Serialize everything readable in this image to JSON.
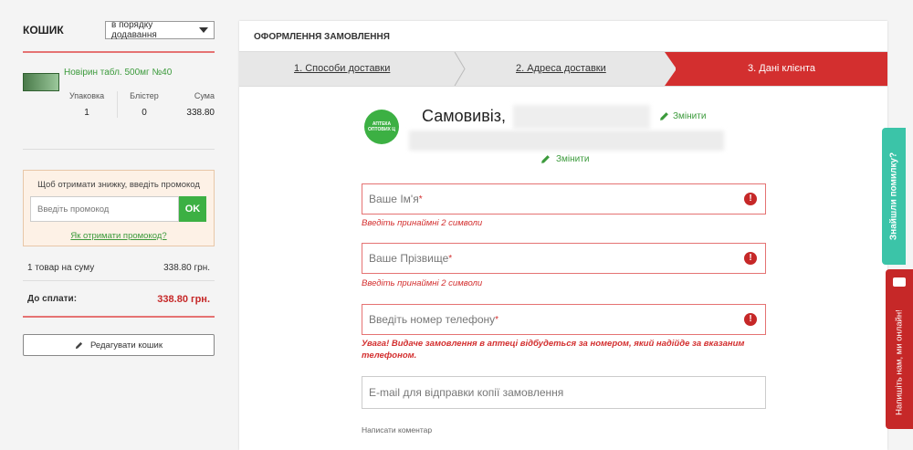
{
  "cart": {
    "title": "КОШИК",
    "sort_value": "в порядку додавання",
    "item": {
      "name": "Новірин табл. 500мг №40",
      "col_pack_label": "Упаковка",
      "col_blister_label": "Блістер",
      "col_sum_label": "Сума",
      "pack_qty": "1",
      "blister_qty": "0",
      "sum": "338.80"
    },
    "promo": {
      "text": "Щоб отримати знижку, введіть промокод",
      "placeholder": "Введіть промокод",
      "ok_label": "OK",
      "link": "Як отримати промокод?"
    },
    "summary": {
      "items_label": "1 товар на суму",
      "items_value": "338.80 грн.",
      "total_label": "До сплати:",
      "total_value": "338.80 грн."
    },
    "edit_label": "Редагувати кошик"
  },
  "checkout": {
    "title": "ОФОРМЛЕННЯ ЗАМОВЛЕННЯ",
    "steps": [
      "1. Способи доставки",
      "2. Адреса доставки",
      "3. Дані клієнта"
    ],
    "logo_text": "АПТЕКА ОПТОВИХ Ц",
    "pickup_label": "Самовивіз,",
    "change_label": "Змінити",
    "fields": {
      "first_name": "Ваше Ім'я",
      "last_name": "Ваше Прізвище",
      "phone": "Введіть номер телефону",
      "email": "E-mail для відправки копії замовлення"
    },
    "error_min2": "Введіть принаймні 2 символи",
    "phone_warning": "Увага! Видаче замовлення в аптеці відбудеться за номером, який надійде за вказаним телефоном.",
    "comment_label": "Написати коментар"
  },
  "widgets": {
    "feedback": "Знайшли помилку?",
    "chat": "Напишіть нам, ми онлайн!"
  },
  "colors": {
    "accent_red": "#d32f2f",
    "green": "#3cb043",
    "teal": "#3bc4a8"
  }
}
